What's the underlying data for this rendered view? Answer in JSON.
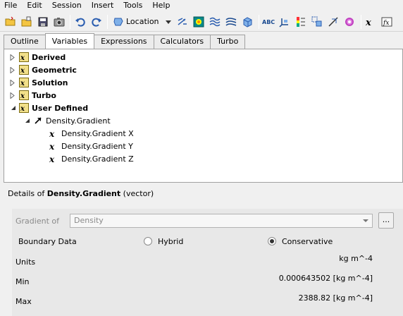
{
  "menu": [
    "File",
    "Edit",
    "Session",
    "Insert",
    "Tools",
    "Help"
  ],
  "toolbar": {
    "location_label": "Location",
    "icons": [
      "open-folder-icon",
      "open-file-icon",
      "save-icon",
      "screenshot-icon",
      "undo-icon",
      "redo-icon",
      "location-icon",
      "vector-icon",
      "contour-icon",
      "streamline-icon",
      "volume-icon",
      "text-icon",
      "coordinate-frame-icon",
      "legend-icon",
      "instance-transform-icon",
      "clip-plane-icon",
      "color-map-icon",
      "variable-icon",
      "expression-icon"
    ]
  },
  "tabs": [
    "Outline",
    "Variables",
    "Expressions",
    "Calculators",
    "Turbo"
  ],
  "active_tab": "Variables",
  "tree": {
    "groups": [
      "Derived",
      "Geometric",
      "Solution",
      "Turbo",
      "User Defined"
    ],
    "variable": "Density.Gradient",
    "components": [
      "Density.Gradient X",
      "Density.Gradient Y",
      "Density.Gradient Z"
    ]
  },
  "details": {
    "prefix": "Details of ",
    "name": "Density.Gradient",
    "suffix": " (vector)",
    "gradient_of_label": "Gradient of",
    "gradient_of_value": "Density",
    "ellipsis": "...",
    "boundary_data_label": "Boundary Data",
    "option_hybrid": "Hybrid",
    "option_conservative": "Conservative",
    "selected_option": "Conservative",
    "units_label": "Units",
    "units_value": "kg m^-4",
    "min_label": "Min",
    "min_value": "0.000643502 [kg m^-4]",
    "max_label": "Max",
    "max_value": "2388.82 [kg m^-4]"
  }
}
